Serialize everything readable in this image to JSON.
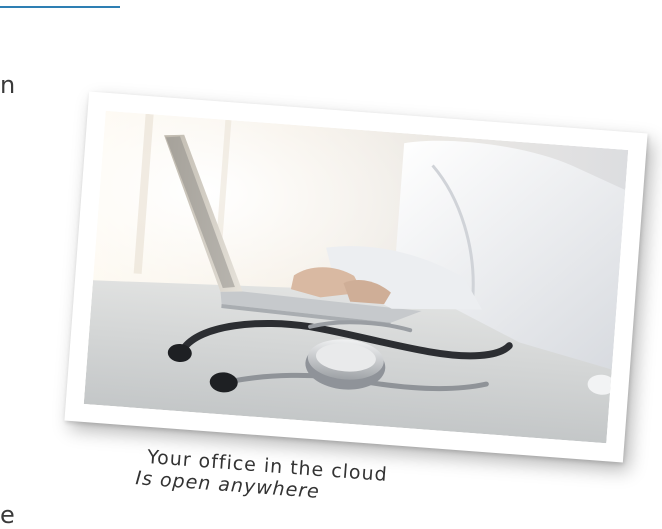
{
  "edge_text": {
    "letter_top": "n",
    "letter_bottom": "e"
  },
  "photo": {
    "subject": "doctor typing on laptop with stethoscope on desk",
    "colors": {
      "window_glow": "#fbf5ea",
      "coat": "#f2f3f5",
      "desk": "#d9dbdb",
      "laptop": "#c9cccf",
      "stethoscope_tube": "#2d2f33",
      "stethoscope_chest": "#c7c9cb"
    }
  },
  "caption": {
    "line1": "Your office in the cloud",
    "line2": "Is open anywhere"
  },
  "accent_color": "#2e7fb3"
}
